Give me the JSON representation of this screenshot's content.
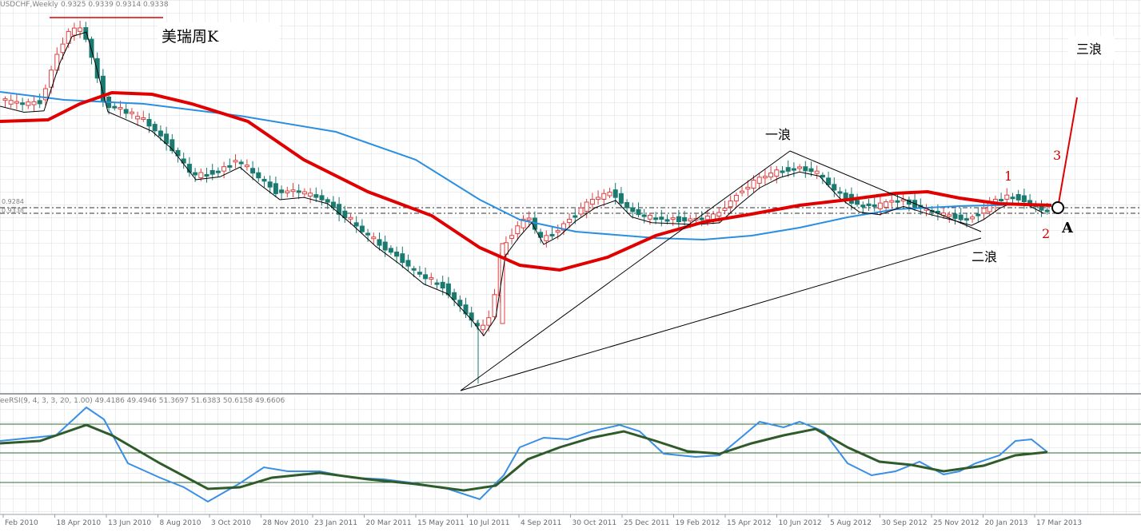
{
  "chart_data": {
    "type": "candlestick",
    "symbol_header": "USDCHF,Weekly",
    "ohlc_header": "0.9325 0.9339 0.9314 0.9338",
    "title_label": "美瑞周K",
    "price_label_left": "0.9284",
    "price_label_left2": "0.9338",
    "indicator_header": "eeRSI(9, 4, 3, 3, 20, 1.00) 49.4186 49.4946 51.3697 51.6383 50.6158 49.6606",
    "x_ticks": [
      "Feb 2010",
      "18 Apr 2010",
      "13 Jun 2010",
      "8 Aug 2010",
      "3 Oct 2010",
      "28 Nov 2010",
      "23 Jan 2011",
      "20 Mar 2011",
      "15 May 2011",
      "10 Jul 2011",
      "4 Sep 2011",
      "30 Oct 2011",
      "25 Dec 2011",
      "19 Feb 2012",
      "15 Apr 2012",
      "10 Jun 2012",
      "5 Aug 2012",
      "30 Sep 2012",
      "25 Nov 2012",
      "20 Jan 2013",
      "17 Mar 2013"
    ],
    "annotations": {
      "wave1": "一浪",
      "wave2": "二浪",
      "wave3": "三浪",
      "n1": "1",
      "n2": "2",
      "n3": "3",
      "point_a": "A"
    },
    "series": [
      {
        "name": "MA-red",
        "color": "#e00000"
      },
      {
        "name": "MA-blue",
        "color": "#2a8fe0"
      },
      {
        "name": "MA-black-fast",
        "color": "#000000"
      }
    ],
    "colors": {
      "bull": "#e04040",
      "bear": "#1a7a70",
      "grid": "#d9dde2",
      "rsi_fast": "#3a8ee6",
      "rsi_slow": "#2f5b2a"
    }
  }
}
